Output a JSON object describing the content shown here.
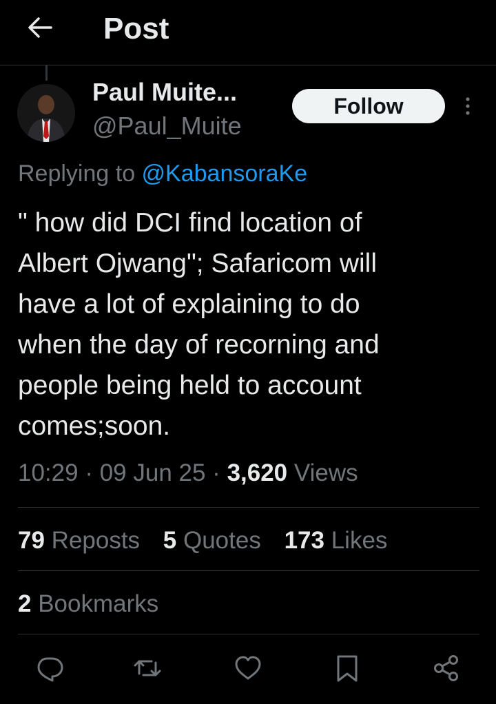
{
  "header": {
    "title": "Post"
  },
  "author": {
    "display_name": "Paul Muite...",
    "handle": "@Paul_Muite",
    "follow_label": "Follow"
  },
  "reply": {
    "prefix": "Replying to ",
    "mention": "@KabansoraKe"
  },
  "tweet": {
    "text": "\" how did DCI find location of\nAlbert Ojwang\"; Safaricom will\nhave a lot of explaining to do\nwhen the day of recorning and\npeople being held to account\ncomes;soon."
  },
  "meta": {
    "time": "10:29",
    "sep1": " · ",
    "date": "09 Jun 25",
    "sep2": " · ",
    "views_count": "3,620",
    "views_label": " Views"
  },
  "stats": {
    "reposts_count": "79",
    "reposts_label": " Reposts",
    "quotes_count": "5",
    "quotes_label": " Quotes",
    "likes_count": "173",
    "likes_label": " Likes",
    "bookmarks_count": "2",
    "bookmarks_label": " Bookmarks"
  },
  "icons": {
    "back": "arrow-left-icon",
    "more": "more-vertical-icon",
    "reply": "reply-icon",
    "repost": "repost-icon",
    "like": "heart-icon",
    "bookmark": "bookmark-icon",
    "share": "share-icon"
  },
  "colors": {
    "background": "#000000",
    "text": "#e7e9ea",
    "secondary": "#71767b",
    "accent": "#1d9bf0",
    "divider": "#2f3336"
  }
}
